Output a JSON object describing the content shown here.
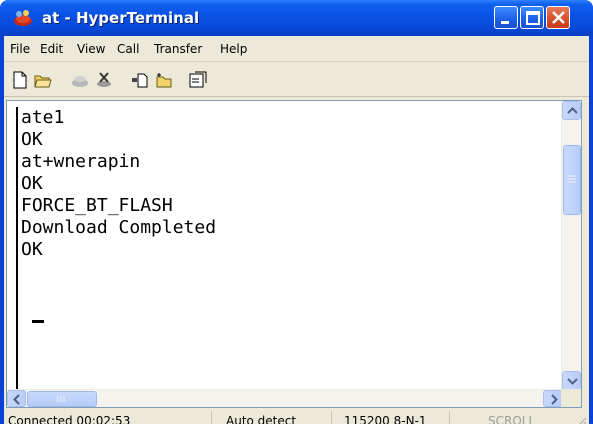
{
  "window": {
    "title": "at - HyperTerminal",
    "title_color": "#ffffff",
    "titlebar_color": "#0a52e6"
  },
  "menu": {
    "items": [
      "File",
      "Edit",
      "View",
      "Call",
      "Transfer",
      "Help"
    ]
  },
  "toolbar": {
    "icons": [
      "new-connection-icon",
      "open-icon",
      "dial-icon",
      "disconnect-icon",
      "send-icon",
      "receive-icon",
      "properties-icon"
    ]
  },
  "terminal": {
    "lines": [
      "ate1",
      "OK",
      "at+wnerapin",
      "OK",
      "FORCE_BT_FLASH",
      "Download Completed",
      "OK"
    ]
  },
  "status": {
    "connected": "Connected 00:02:53",
    "detect": "Auto detect",
    "port_settings": "115200 8-N-1",
    "scroll": "SCROLL"
  }
}
